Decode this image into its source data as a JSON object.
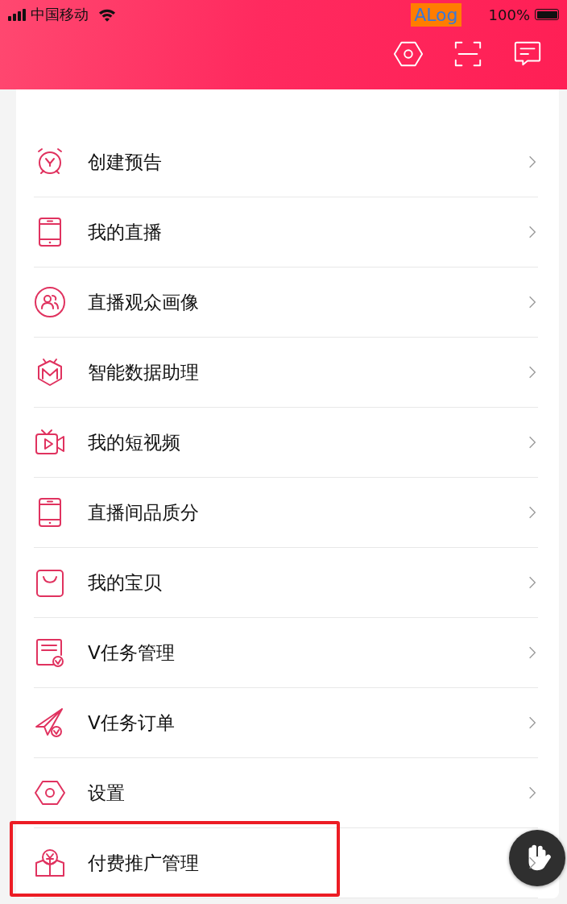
{
  "status_bar": {
    "carrier": "中国移动",
    "debug_badge": "ALog",
    "battery": "100%"
  },
  "header": {
    "actions": [
      {
        "kind": "settings"
      },
      {
        "kind": "scan"
      },
      {
        "kind": "message"
      }
    ]
  },
  "section": {
    "items": [
      {
        "label": "创建预告",
        "kind": "alarm",
        "highlighted": false
      },
      {
        "label": "我的直播",
        "kind": "tablet",
        "highlighted": false
      },
      {
        "label": "直播观众画像",
        "kind": "audience",
        "highlighted": false
      },
      {
        "label": "智能数据助理",
        "kind": "robot",
        "highlighted": false
      },
      {
        "label": "我的短视频",
        "kind": "video",
        "highlighted": false
      },
      {
        "label": "直播间品质分",
        "kind": "tablet",
        "highlighted": false
      },
      {
        "label": "我的宝贝",
        "kind": "bag",
        "highlighted": false
      },
      {
        "label": "V任务管理",
        "kind": "task",
        "highlighted": false
      },
      {
        "label": "V任务订单",
        "kind": "plane",
        "highlighted": false
      },
      {
        "label": "设置",
        "kind": "settings",
        "highlighted": false
      },
      {
        "label": "付费推广管理",
        "kind": "promo",
        "highlighted": true
      }
    ]
  }
}
